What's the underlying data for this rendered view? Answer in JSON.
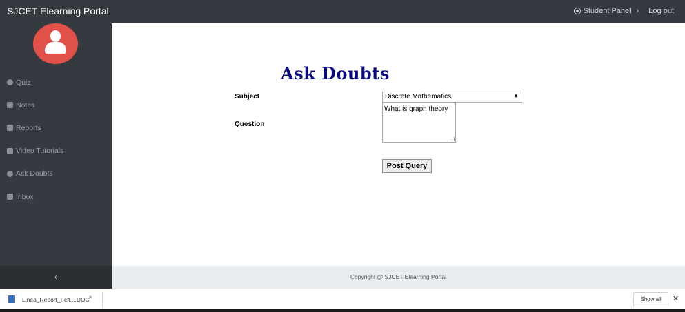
{
  "header": {
    "brand": "SJCET Elearning Portal",
    "student_panel": "Student Panel",
    "logout": "Log out",
    "chevron": "›"
  },
  "sidebar": {
    "items": [
      {
        "label": "Quiz",
        "icon": "question-circle-icon"
      },
      {
        "label": "Notes",
        "icon": "book-icon"
      },
      {
        "label": "Reports",
        "icon": "file-icon"
      },
      {
        "label": "Video Tutorials",
        "icon": "video-icon"
      },
      {
        "label": "Ask Doubts",
        "icon": "question-circle-icon"
      },
      {
        "label": "Inbox",
        "icon": "envelope-icon"
      }
    ],
    "toggle": "‹"
  },
  "main": {
    "title": "Ask Doubts",
    "subject_label": "Subject",
    "question_label": "Question",
    "subject_value": "Discrete Mathematics",
    "question_value": "What is graph theory",
    "submit_label": "Post Query"
  },
  "footer": {
    "copyright": "Copyright @ SJCET Elearning Portal"
  },
  "downloads": {
    "file_name": "Linea_Report_Fclt....DOC",
    "caret": "^",
    "show_all": "Show all",
    "close": "✕"
  },
  "colors": {
    "topbar": "#353a40",
    "avatar": "#e0514a",
    "title": "#0a0a7a"
  }
}
